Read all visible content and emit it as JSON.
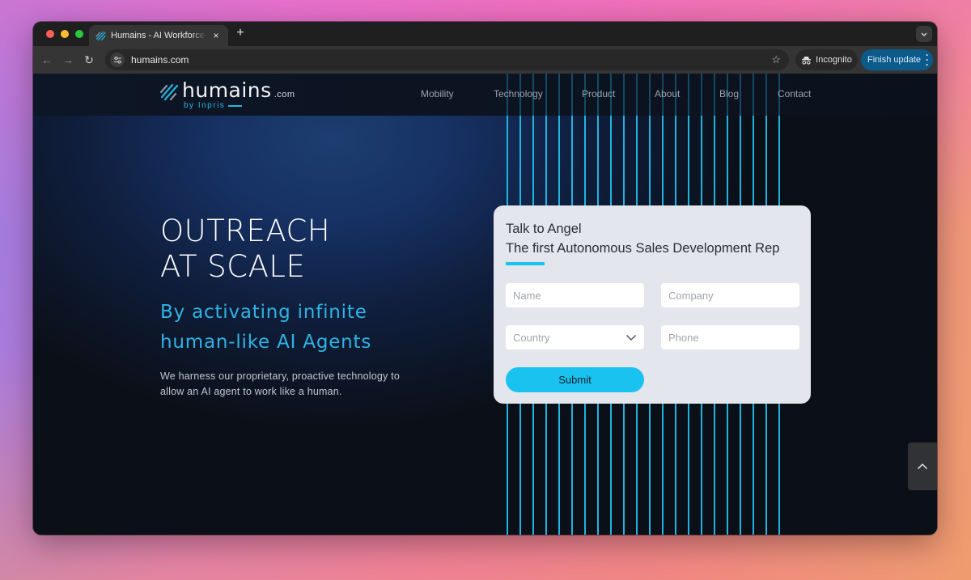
{
  "browser": {
    "tab": {
      "title": "Humains - AI Workforce Revolution",
      "favicon": "humains-logo-icon"
    },
    "url": "humains.com",
    "incognito_label": "Incognito",
    "finish_update_label": "Finish update",
    "icons": {
      "back": "←",
      "forward": "→",
      "reload": "↻",
      "close_tab": "×",
      "new_tab": "+",
      "bookmark": "☆",
      "tab_search": "⌄"
    }
  },
  "site": {
    "logo": {
      "name": "humains",
      "tld": ".com",
      "byline": "by Inpris"
    },
    "nav": [
      {
        "label": "Mobility"
      },
      {
        "label": "Technology"
      },
      {
        "label": "Product"
      },
      {
        "label": "About"
      },
      {
        "label": "Blog"
      },
      {
        "label": "Contact"
      }
    ],
    "hero": {
      "title_line1": "OUTREACH",
      "title_line2": "AT SCALE",
      "subtitle_line1": "By activating infinite",
      "subtitle_line2": "human-like AI Agents",
      "description_line1": "We harness our proprietary, proactive technology to",
      "description_line2": "allow an AI agent to work like a human."
    },
    "form": {
      "heading_line1": "Talk to Angel",
      "heading_line2": "The first Autonomous Sales Development Rep",
      "fields": {
        "name_placeholder": "Name",
        "company_placeholder": "Company",
        "country_placeholder": "Country",
        "phone_placeholder": "Phone"
      },
      "submit_label": "Submit"
    },
    "colors": {
      "accent": "#1ac3ef",
      "brand_blue": "#2fb3e3",
      "background": "#0b0f17",
      "card": "#e3e7ed",
      "update_button": "#0b5a8a"
    }
  }
}
